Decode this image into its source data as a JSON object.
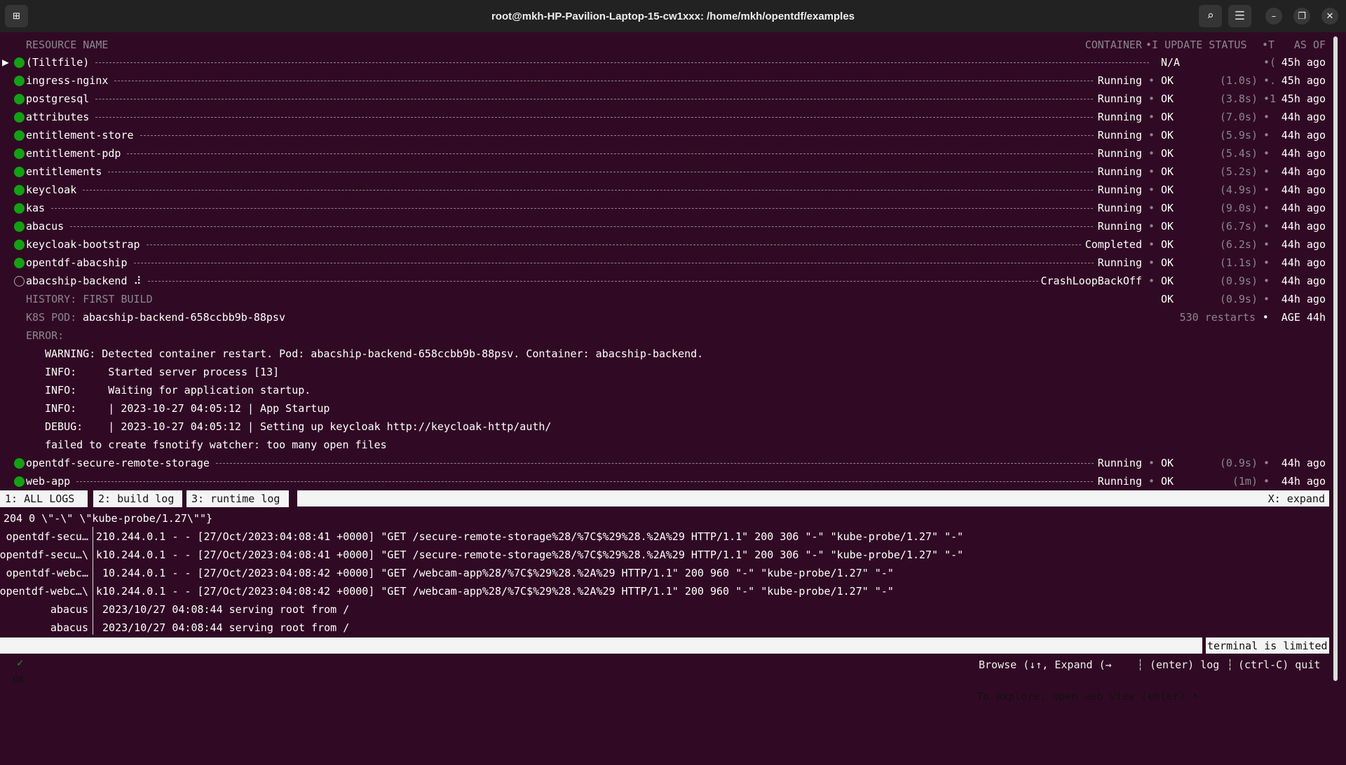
{
  "window": {
    "title": "root@mkh-HP-Pavilion-Laptop-15-cw1xxx: /home/mkh/opentdf/examples",
    "icons": {
      "new_tab": "new-tab-icon",
      "search": "search-icon",
      "menu": "hamburger-menu-icon",
      "minimize": "minimize-icon",
      "maximize": "restore-icon",
      "close": "close-icon"
    }
  },
  "colors": {
    "background": "#300a24",
    "ok_green": "#14a014",
    "titlebar": "#222222"
  },
  "header": {
    "resource_name": "RESOURCE NAME",
    "container": "CONTAINER",
    "update_status": "•I UPDATE STATUS",
    "t": "•T",
    "as_of": "AS OF"
  },
  "resources": [
    {
      "name": "(Tiltfile)",
      "container": "",
      "sep": "",
      "update": "N/A",
      "duration": "",
      "extra": "•(",
      "age": "45h ago",
      "state": "ok",
      "selected": true
    },
    {
      "name": "ingress-nginx",
      "container": "Running",
      "sep": "•",
      "update": "OK",
      "duration": "(1.0s)",
      "extra": "•.",
      "age": "45h ago",
      "state": "ok"
    },
    {
      "name": "postgresql",
      "container": "Running",
      "sep": "•",
      "update": "OK",
      "duration": "(3.8s)",
      "extra": "•1",
      "age": "45h ago",
      "state": "ok"
    },
    {
      "name": "attributes",
      "container": "Running",
      "sep": "•",
      "update": "OK",
      "duration": "(7.0s)",
      "extra": "•",
      "age": "44h ago",
      "state": "ok"
    },
    {
      "name": "entitlement-store",
      "container": "Running",
      "sep": "•",
      "update": "OK",
      "duration": "(5.9s)",
      "extra": "•",
      "age": "44h ago",
      "state": "ok"
    },
    {
      "name": "entitlement-pdp",
      "container": "Running",
      "sep": "•",
      "update": "OK",
      "duration": "(5.4s)",
      "extra": "•",
      "age": "44h ago",
      "state": "ok"
    },
    {
      "name": "entitlements",
      "container": "Running",
      "sep": "•",
      "update": "OK",
      "duration": "(5.2s)",
      "extra": "•",
      "age": "44h ago",
      "state": "ok"
    },
    {
      "name": "keycloak",
      "container": "Running",
      "sep": "•",
      "update": "OK",
      "duration": "(4.9s)",
      "extra": "•",
      "age": "44h ago",
      "state": "ok"
    },
    {
      "name": "kas",
      "container": "Running",
      "sep": "•",
      "update": "OK",
      "duration": "(9.0s)",
      "extra": "•",
      "age": "44h ago",
      "state": "ok"
    },
    {
      "name": "abacus",
      "container": "Running",
      "sep": "•",
      "update": "OK",
      "duration": "(6.7s)",
      "extra": "•",
      "age": "44h ago",
      "state": "ok"
    },
    {
      "name": "keycloak-bootstrap",
      "container": "Completed",
      "sep": "•",
      "update": "OK",
      "duration": "(6.2s)",
      "extra": "•",
      "age": "44h ago",
      "state": "ok"
    },
    {
      "name": "opentdf-abacship",
      "container": "Running",
      "sep": "•",
      "update": "OK",
      "duration": "(1.1s)",
      "extra": "•",
      "age": "44h ago",
      "state": "ok"
    },
    {
      "name": "abacship-backend ⠼",
      "container": "CrashLoopBackOff",
      "sep": "•",
      "update": "OK",
      "duration": "(0.9s)",
      "extra": "•",
      "age": "44h ago",
      "state": "pending"
    }
  ],
  "detail": {
    "history_label": "HISTORY: FIRST BUILD",
    "history_update": "OK",
    "history_duration": "(0.9s)",
    "history_extra": "•",
    "history_age": "44h ago",
    "pod_label": "K8S POD:",
    "pod_name": "abacship-backend-658ccbb9b-88psv",
    "restarts": "530 restarts",
    "age_label": "•  AGE 44h",
    "error_label": "ERROR:",
    "error_lines": [
      "WARNING: Detected container restart. Pod: abacship-backend-658ccbb9b-88psv. Container: abacship-backend.",
      "INFO:     Started server process [13]",
      "INFO:     Waiting for application startup.",
      "INFO:     | 2023-10-27 04:05:12 | App Startup",
      "DEBUG:    | 2023-10-27 04:05:12 | Setting up keycloak http://keycloak-http/auth/",
      "failed to create fsnotify watcher: too many open files"
    ]
  },
  "resources_after": [
    {
      "name": "opentdf-secure-remote-storage",
      "container": "Running",
      "sep": "•",
      "update": "OK",
      "duration": "(0.9s)",
      "extra": "•",
      "age": "44h ago",
      "state": "ok"
    },
    {
      "name": "web-app",
      "container": "Running",
      "sep": "•",
      "update": "OK",
      "duration": "(1m)",
      "extra": "•",
      "age": "44h ago",
      "state": "ok"
    }
  ],
  "tabs": [
    {
      "label": "1: ALL LOGS"
    },
    {
      "label": "2: build log"
    },
    {
      "label": "3: runtime log"
    }
  ],
  "expand_hint": "X: expand",
  "log_first": "204 0 \\\"-\\\" \\\"kube-probe/1.27\\\"\"}",
  "logs": [
    {
      "prefix": "opentdf-secu…",
      "text": "210.244.0.1 - - [27/Oct/2023:04:08:41 +0000] \"GET /secure-remote-storage%28/%7C$%29%28.%2A%29 HTTP/1.1\" 200 306 \"-\" \"kube-probe/1.27\" \"-\""
    },
    {
      "prefix": "opentdf-secu…\\",
      "text": "k10.244.0.1 - - [27/Oct/2023:04:08:41 +0000] \"GET /secure-remote-storage%28/%7C$%29%28.%2A%29 HTTP/1.1\" 200 306 \"-\" \"kube-probe/1.27\" \"-\""
    },
    {
      "prefix": "opentdf-webc…",
      "text": " 10.244.0.1 - - [27/Oct/2023:04:08:42 +0000] \"GET /webcam-app%28/%7C$%29%28.%2A%29 HTTP/1.1\" 200 960 \"-\" \"kube-probe/1.27\" \"-\""
    },
    {
      "prefix": "opentdf-webc…\\",
      "text": "k10.244.0.1 - - [27/Oct/2023:04:08:42 +0000] \"GET /webcam-app%28/%7C$%29%28.%2A%29 HTTP/1.1\" 200 960 \"-\" \"kube-probe/1.27\" \"-\""
    },
    {
      "prefix": "abacus",
      "text": " 2023/10/27 04:08:44 serving root from /"
    },
    {
      "prefix": "abacus",
      "text": " 2023/10/27 04:08:44 serving root from /"
    }
  ],
  "status": {
    "check": "✓",
    "ok": "OK",
    "explore": "To explore, open web view (enter) •",
    "limited": "terminal is limited"
  },
  "help": {
    "browse": "Browse (↓↑, Expand (→",
    "log": "(enter) log",
    "quit": "(ctrl-C) quit"
  }
}
